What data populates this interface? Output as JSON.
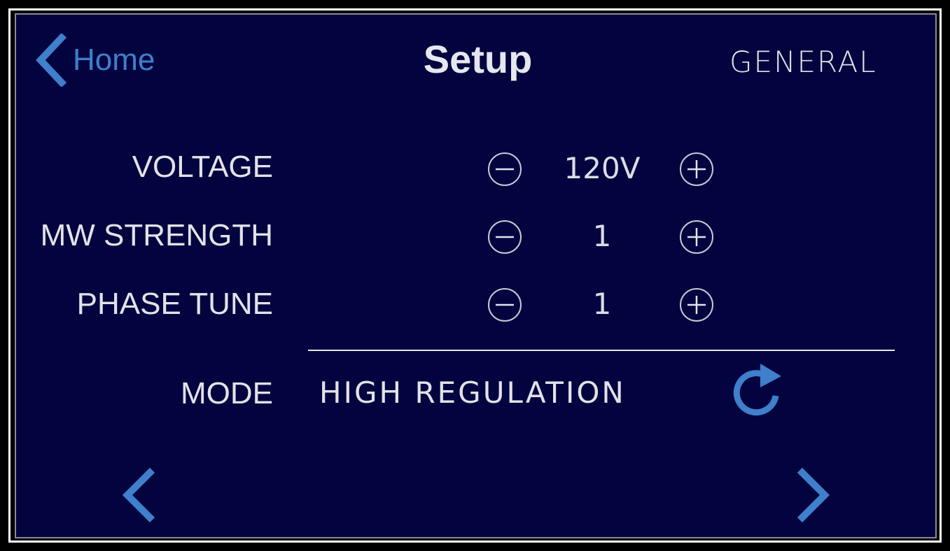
{
  "header": {
    "back_label": "Home",
    "title": "Setup",
    "section": "GENERAL"
  },
  "settings": [
    {
      "label": "VOLTAGE",
      "value": "120V"
    },
    {
      "label": "MW STRENGTH",
      "value": "1"
    },
    {
      "label": "PHASE TUNE",
      "value": "1"
    }
  ],
  "mode": {
    "label": "MODE",
    "value": "HIGH REGULATION"
  },
  "icons": {
    "back": "chevron-left-icon",
    "decrement": "minus-circle-icon",
    "increment": "plus-circle-icon",
    "mode_cycle": "refresh-icon",
    "prev_page": "chevron-left-icon",
    "next_page": "chevron-right-icon"
  },
  "colors": {
    "background": "#03043f",
    "accent": "#3f7fcb",
    "text": "#e2e2ea",
    "frame": "#ffffff"
  }
}
